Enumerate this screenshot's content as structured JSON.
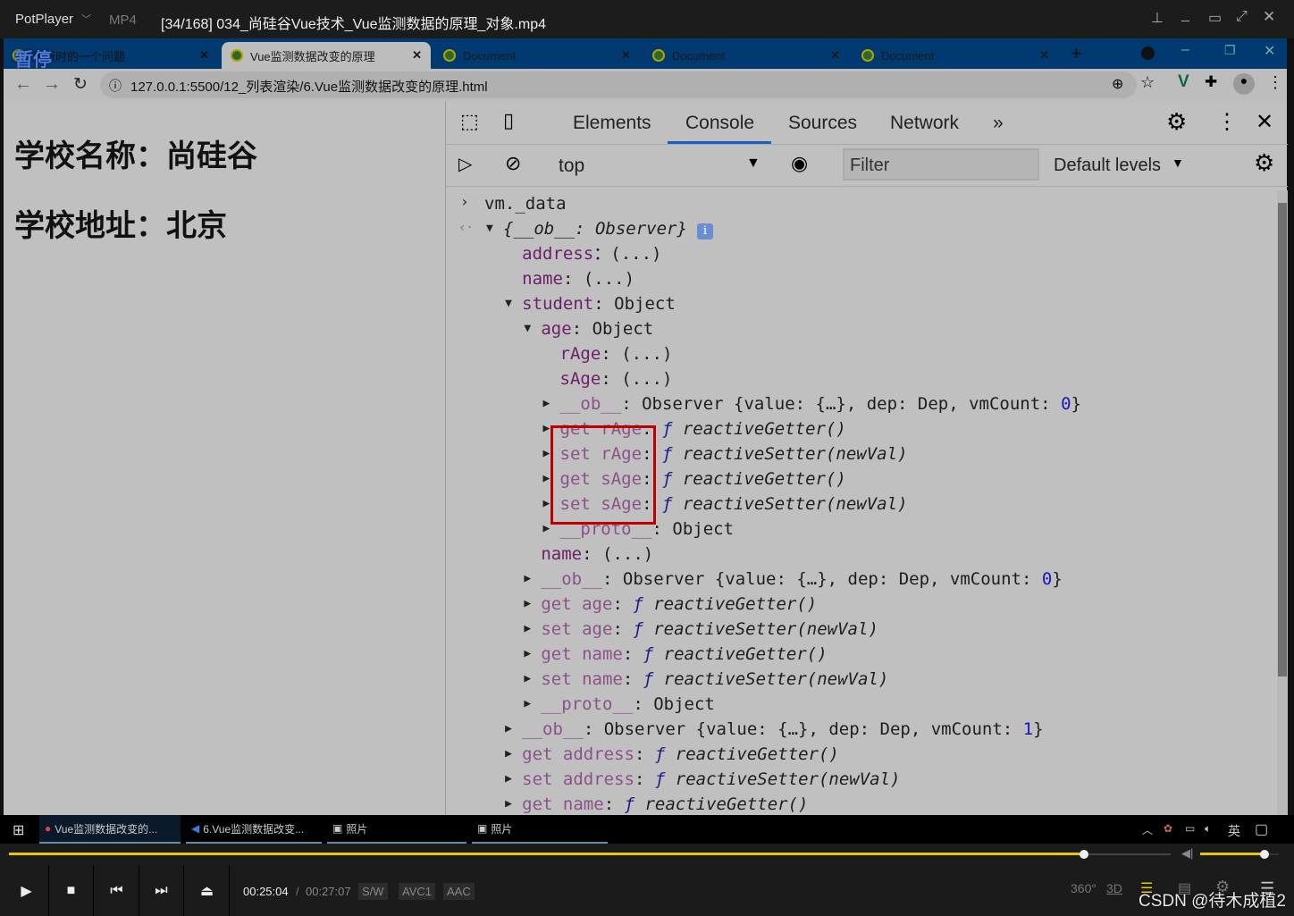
{
  "player": {
    "app": "PotPlayer",
    "format": "MP4",
    "title": "[34/168] 034_尚硅谷Vue技术_Vue监测数据的原理_对象.mp4",
    "paused_overlay": "暂停",
    "time_current": "00:25:04",
    "time_total": "00:27:07",
    "badges": [
      "S/W",
      "AVC1",
      "AAC"
    ],
    "progress": 0.925,
    "volume": 0.82,
    "watermark": "CSDN @待木成植2"
  },
  "browser": {
    "tabs": [
      {
        "label": "更新时的一个问题"
      },
      {
        "label": "Vue监测数据改变的原理",
        "active": true
      },
      {
        "label": "Document"
      },
      {
        "label": "Document"
      },
      {
        "label": "Document"
      }
    ],
    "url": "127.0.0.1:5500/12_列表渲染/6.Vue监测数据改变的原理.html"
  },
  "page": {
    "line1": "学校名称：尚硅谷",
    "line2": "学校地址：北京"
  },
  "devtools": {
    "tabs": [
      "Elements",
      "Console",
      "Sources",
      "Network"
    ],
    "active_tab": "Console",
    "context": "top",
    "filter_placeholder": "Filter",
    "levels": "Default levels"
  },
  "console": {
    "input": "vm._data",
    "lines": [
      {
        "ind": 0,
        "arrow": "down",
        "parts": [
          [
            "i",
            "{__ob__: Observer}"
          ]
        ]
      },
      {
        "ind": 1,
        "parts": [
          [
            "k",
            "address"
          ],
          [
            "",
            "：(...)"
          ]
        ]
      },
      {
        "ind": 1,
        "parts": [
          [
            "k",
            "name"
          ],
          [
            "",
            ": (...)"
          ]
        ]
      },
      {
        "ind": 1,
        "arrow": "down",
        "parts": [
          [
            "k",
            "student"
          ],
          [
            "",
            ": Object"
          ]
        ]
      },
      {
        "ind": 2,
        "arrow": "down",
        "parts": [
          [
            "k",
            "age"
          ],
          [
            "",
            ": Object"
          ]
        ]
      },
      {
        "ind": 3,
        "parts": [
          [
            "k",
            "rAge"
          ],
          [
            "",
            ": (...)"
          ]
        ]
      },
      {
        "ind": 3,
        "parts": [
          [
            "k",
            "sAge"
          ],
          [
            "",
            ": (...)"
          ]
        ]
      },
      {
        "ind": 3,
        "arrow": "right",
        "parts": [
          [
            "kd",
            "__ob__"
          ],
          [
            "",
            ": Observer {value: {…}, dep: Dep, vmCount: "
          ],
          [
            "num",
            "0"
          ],
          [
            "",
            "}"
          ]
        ]
      },
      {
        "ind": 3,
        "arrow": "right",
        "parts": [
          [
            "kd",
            "get rAge"
          ],
          [
            "",
            ": "
          ],
          [
            "f",
            "ƒ"
          ],
          [
            "i",
            " reactiveGetter()"
          ]
        ]
      },
      {
        "ind": 3,
        "arrow": "right",
        "parts": [
          [
            "kd",
            "set rAge"
          ],
          [
            "",
            ": "
          ],
          [
            "f",
            "ƒ"
          ],
          [
            "i",
            " reactiveSetter(newVal)"
          ]
        ]
      },
      {
        "ind": 3,
        "arrow": "right",
        "parts": [
          [
            "kd",
            "get sAge"
          ],
          [
            "",
            ": "
          ],
          [
            "f",
            "ƒ"
          ],
          [
            "i",
            " reactiveGetter()"
          ]
        ]
      },
      {
        "ind": 3,
        "arrow": "right",
        "parts": [
          [
            "kd",
            "set sAge"
          ],
          [
            "",
            ": "
          ],
          [
            "f",
            "ƒ"
          ],
          [
            "i",
            " reactiveSetter(newVal)"
          ]
        ]
      },
      {
        "ind": 3,
        "arrow": "right",
        "parts": [
          [
            "kd",
            "__proto__"
          ],
          [
            "",
            ": Object"
          ]
        ]
      },
      {
        "ind": 2,
        "parts": [
          [
            "k",
            "name"
          ],
          [
            "",
            ": (...)"
          ]
        ]
      },
      {
        "ind": 2,
        "arrow": "right",
        "parts": [
          [
            "kd",
            "__ob__"
          ],
          [
            "",
            ": Observer {value: {…}, dep: Dep, vmCount: "
          ],
          [
            "num",
            "0"
          ],
          [
            "",
            "}"
          ]
        ]
      },
      {
        "ind": 2,
        "arrow": "right",
        "parts": [
          [
            "kd",
            "get age"
          ],
          [
            "",
            ": "
          ],
          [
            "f",
            "ƒ"
          ],
          [
            "i",
            " reactiveGetter()"
          ]
        ]
      },
      {
        "ind": 2,
        "arrow": "right",
        "parts": [
          [
            "kd",
            "set age"
          ],
          [
            "",
            ": "
          ],
          [
            "f",
            "ƒ"
          ],
          [
            "i",
            " reactiveSetter(newVal)"
          ]
        ]
      },
      {
        "ind": 2,
        "arrow": "right",
        "parts": [
          [
            "kd",
            "get name"
          ],
          [
            "",
            ": "
          ],
          [
            "f",
            "ƒ"
          ],
          [
            "i",
            " reactiveGetter()"
          ]
        ]
      },
      {
        "ind": 2,
        "arrow": "right",
        "parts": [
          [
            "kd",
            "set name"
          ],
          [
            "",
            ": "
          ],
          [
            "f",
            "ƒ"
          ],
          [
            "i",
            " reactiveSetter(newVal)"
          ]
        ]
      },
      {
        "ind": 2,
        "arrow": "right",
        "parts": [
          [
            "kd",
            "__proto__"
          ],
          [
            "",
            ": Object"
          ]
        ]
      },
      {
        "ind": 1,
        "arrow": "right",
        "parts": [
          [
            "kd",
            "__ob__"
          ],
          [
            "",
            ": Observer {value: {…}, dep: Dep, vmCount: "
          ],
          [
            "num",
            "1"
          ],
          [
            "",
            "}"
          ]
        ]
      },
      {
        "ind": 1,
        "arrow": "right",
        "parts": [
          [
            "kd",
            "get address"
          ],
          [
            "",
            ": "
          ],
          [
            "f",
            "ƒ"
          ],
          [
            "i",
            " reactiveGetter()"
          ]
        ]
      },
      {
        "ind": 1,
        "arrow": "right",
        "parts": [
          [
            "kd",
            "set address"
          ],
          [
            "",
            ": "
          ],
          [
            "f",
            "ƒ"
          ],
          [
            "i",
            " reactiveSetter(newVal)"
          ]
        ]
      },
      {
        "ind": 1,
        "arrow": "right",
        "parts": [
          [
            "kd",
            "get name"
          ],
          [
            "",
            ": "
          ],
          [
            "f",
            "ƒ"
          ],
          [
            "i",
            " reactiveGetter()"
          ]
        ]
      }
    ]
  },
  "taskbar": {
    "items": [
      "Vue监测数据改变的...",
      "6.Vue监测数据改变...",
      "照片",
      "照片"
    ],
    "ime": "英"
  },
  "colors": {
    "highlight_box": "#c00000",
    "seek": "#e8c800",
    "tabbar": "#003a70"
  }
}
